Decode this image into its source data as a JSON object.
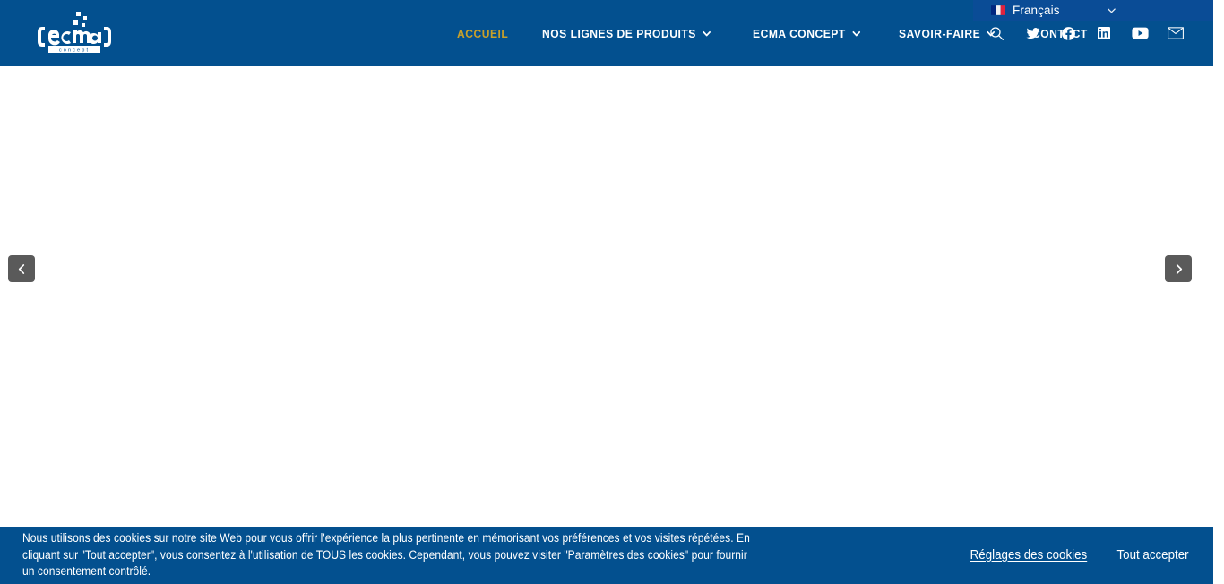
{
  "colors": {
    "header_blue": "#03508f",
    "lang_bar_blue": "#0a4c96",
    "active_nav_gold": "#c8a02a",
    "arrow_gray": "#5a5a5a",
    "page_background": "#ffffff",
    "text_white": "#ffffff"
  },
  "language_bar": {
    "flag_icon": "flag-france-icon",
    "label": "Français",
    "caret_icon": "chevron-down-icon"
  },
  "header": {
    "logo": {
      "icon": "ecma-concept-logo",
      "wordmark": "ecma",
      "tagline": "c o n c e p t"
    },
    "nav": [
      {
        "label": "ACCUEIL",
        "active": true,
        "has_dropdown": false,
        "name": "nav-item-accueil"
      },
      {
        "label": "NOS LIGNES DE PRODUITS",
        "active": false,
        "has_dropdown": true,
        "name": "nav-item-nos-lignes-de-produits"
      },
      {
        "label": "ECMA CONCEPT",
        "active": false,
        "has_dropdown": true,
        "name": "nav-item-ecma-concept"
      },
      {
        "label": "SAVOIR-FAIRE",
        "active": false,
        "has_dropdown": true,
        "name": "nav-item-savoir-faire"
      },
      {
        "label": "CONTACT",
        "active": false,
        "has_dropdown": false,
        "name": "nav-item-contact"
      }
    ],
    "icons": [
      {
        "name": "search-icon",
        "title": "Recherche"
      },
      {
        "name": "twitter-icon",
        "title": "Twitter"
      },
      {
        "name": "facebook-icon",
        "title": "Facebook"
      },
      {
        "name": "linkedin-icon",
        "title": "LinkedIn"
      },
      {
        "name": "youtube-icon",
        "title": "YouTube"
      },
      {
        "name": "email-icon",
        "title": "Email"
      }
    ]
  },
  "slider": {
    "prev_label": "Précédent",
    "next_label": "Suivant",
    "prev_icon": "chevron-left-icon",
    "next_icon": "chevron-right-icon"
  },
  "cookie_banner": {
    "message": "Nous utilisons des cookies sur notre site Web pour vous offrir l'expérience la plus pertinente en mémorisant vos préférences et vos visites répétées. En cliquant sur \"Tout accepter\", vous consentez à l'utilisation de TOUS les cookies. Cependant, vous pouvez visiter \"Paramètres des cookies\" pour fournir un consentement contrôlé.",
    "settings_label": "Réglages des cookies",
    "accept_label": "Tout accepter"
  }
}
